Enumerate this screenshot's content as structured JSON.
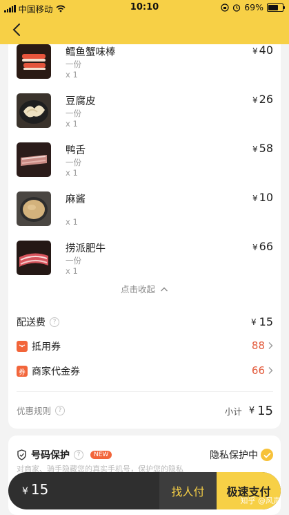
{
  "status_bar": {
    "carrier": "中国移动",
    "time": "10:10",
    "battery": "69%"
  },
  "items": [
    {
      "name": "鳕鱼蟹味棒",
      "spec": "一份",
      "qty": "x 1",
      "price": "40",
      "currency": "¥",
      "thumb": "crab-stick-photo"
    },
    {
      "name": "豆腐皮",
      "spec": "一份",
      "qty": "x 1",
      "price": "26",
      "currency": "¥",
      "thumb": "tofu-skin-photo"
    },
    {
      "name": "鸭舌",
      "spec": "一份",
      "qty": "x 1",
      "price": "58",
      "currency": "¥",
      "thumb": "duck-tongue-photo"
    },
    {
      "name": "麻酱",
      "spec": "",
      "qty": "x 1",
      "price": "10",
      "currency": "¥",
      "thumb": "sesame-sauce-photo"
    },
    {
      "name": "捞派肥牛",
      "spec": "一份",
      "qty": "x 1",
      "price": "66",
      "currency": "¥",
      "thumb": "beef-slices-photo"
    }
  ],
  "collapse_label": "点击收起",
  "delivery": {
    "label": "配送费",
    "currency": "¥",
    "value": "15"
  },
  "coupon": {
    "label": "抵用券",
    "value": "88"
  },
  "merchant_coupon": {
    "label": "商家代金券",
    "icon_char": "券",
    "value": "66"
  },
  "summary": {
    "rules_label": "优惠规则",
    "subtotal_label": "小计",
    "currency": "¥",
    "subtotal": "15"
  },
  "privacy": {
    "title": "号码保护",
    "badge": "NEW",
    "status": "隐私保护中",
    "desc": "对商家、骑手隐藏您的真实手机号，保护您的隐私"
  },
  "paybar": {
    "currency": "¥",
    "total": "15",
    "find_pay": "找人付",
    "fast_pay": "极速支付"
  },
  "watermark": "知乎 @风声",
  "colors": {
    "brand_yellow": "#f7d046",
    "accent_red": "#f2653a",
    "dark": "#2f2f2f"
  }
}
